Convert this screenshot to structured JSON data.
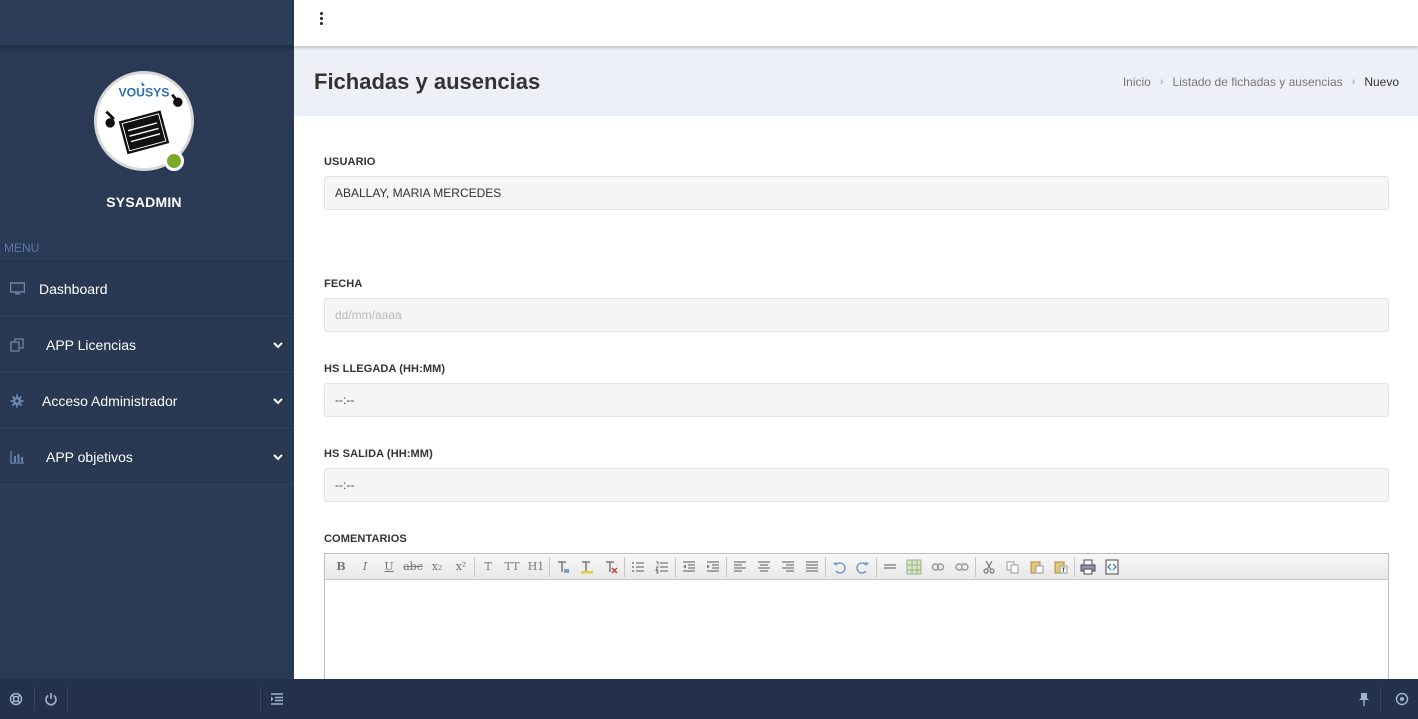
{
  "sidebar": {
    "username": "SYSADMIN",
    "menu_label": "MENU",
    "avatar_text": "VOUSYS",
    "items": [
      {
        "label": "Dashboard",
        "icon": "monitor-icon"
      },
      {
        "label": "APP Licencias",
        "icon": "copy-icon",
        "has_submenu": true
      },
      {
        "label": "Acceso Administrador",
        "icon": "gear-icon",
        "has_submenu": true
      },
      {
        "label": "APP objetivos",
        "icon": "bar-chart-icon",
        "has_submenu": true
      }
    ],
    "status_color": "#7cab2c"
  },
  "header": {
    "title": "Fichadas y ausencias",
    "breadcrumb": {
      "home": "Inicio",
      "list": "Listado de fichadas y ausencias",
      "current": "Nuevo"
    }
  },
  "form": {
    "usuario": {
      "label": "USUARIO",
      "value": "ABALLAY, MARIA MERCEDES"
    },
    "fecha": {
      "label": "FECHA",
      "placeholder": "dd/mm/aaaa"
    },
    "llegada": {
      "label": "HS LLEGADA (HH:MM)",
      "value": "--:--"
    },
    "salida": {
      "label": "HS SALIDA (HH:MM)",
      "value": "--:--"
    },
    "comentarios": {
      "label": "COMENTARIOS"
    }
  },
  "editor_toolbar": {
    "bold": "B",
    "italic": "I",
    "underline": "U",
    "strike": "abc",
    "subscript": "x₂",
    "superscript": "x²",
    "font": "T",
    "size": "TT",
    "heading": "H1"
  },
  "colors": {
    "sidebar": "#2a3a55",
    "bottom_bar": "#23324a",
    "page_header": "#eef0f8"
  }
}
